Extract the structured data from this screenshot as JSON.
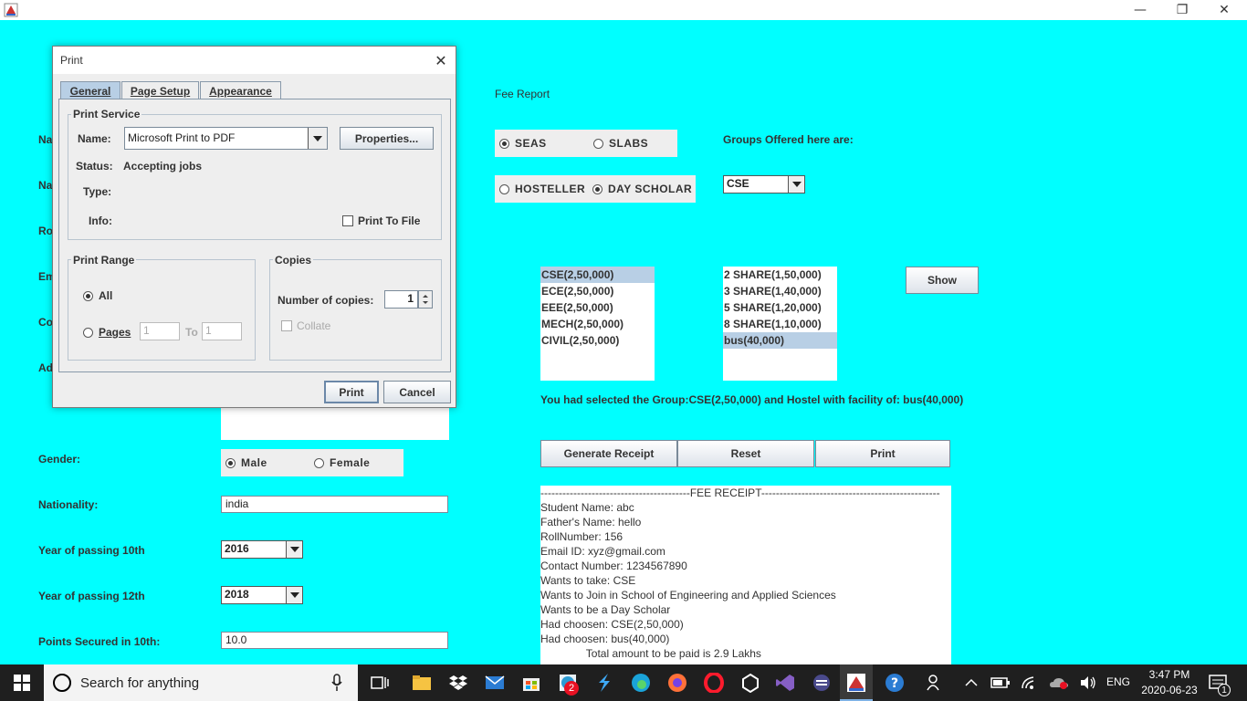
{
  "window": {
    "minimize": "—",
    "restore": "❐",
    "close": "✕"
  },
  "form": {
    "gender_label": "Gender:",
    "gender_male": "Male",
    "gender_female": "Female",
    "nationality_label": "Nationality:",
    "nationality_value": "india",
    "y10_label": "Year of passing 10th",
    "y10_value": "2016",
    "y12_label": "Year of passing 12th",
    "y12_value": "2018",
    "points_label": "Points Secured in 10th:",
    "points_value": "10.0",
    "partial_labels": [
      "Na",
      "Na",
      "Ro",
      "Em",
      "Co",
      "Ad"
    ]
  },
  "fee": {
    "title": "Fee Report",
    "seas": "SEAS",
    "slabs": "SLABS",
    "hosteller": "HOSTELLER",
    "day_scholar": "DAY SCHOLAR",
    "groups_label": "Groups Offered here are:",
    "group_combo": "CSE",
    "groups": [
      "CSE(2,50,000)",
      "ECE(2,50,000)",
      "EEE(2,50,000)",
      "MECH(2,50,000)",
      "CIVIL(2,50,000)"
    ],
    "hostels": [
      "2 SHARE(1,50,000)",
      "3 SHARE(1,40,000)",
      "5 SHARE(1,20,000)",
      "8 SHARE(1,10,000)",
      "bus(40,000)"
    ],
    "show": "Show",
    "selection_text": "You had selected the Group:CSE(2,50,000) and Hostel with facility of: bus(40,000)",
    "generate": "Generate Receipt",
    "reset": "Reset",
    "print": "Print",
    "receipt": [
      "-----------------------------------------FEE RECEIPT-------------------------------------------------",
      "Student Name: abc",
      "Father's Name: hello",
      "RollNumber: 156",
      "Email ID: xyz@gmail.com",
      "Contact Number: 1234567890",
      "Wants to take: CSE",
      "Wants to Join in School of Engineering and Applied Sciences",
      "Wants to be a Day Scholar",
      "Had choosen: CSE(2,50,000)",
      "Had choosen: bus(40,000)",
      "               Total amount to be paid is 2.9 Lakhs"
    ]
  },
  "dialog": {
    "title": "Print",
    "close": "✕",
    "tabs": [
      "General",
      "Page Setup",
      "Appearance"
    ],
    "print_service": "Print Service",
    "name_label": "Name:",
    "name_value": "Microsoft Print to PDF",
    "properties": "Properties...",
    "status_label": "Status:",
    "status_value": "Accepting jobs",
    "type_label": "Type:",
    "info_label": "Info:",
    "print_to_file": "Print To File",
    "print_range": "Print Range",
    "all": "All",
    "pages": "Pages",
    "pages_from": "1",
    "to": "To",
    "pages_to": "1",
    "copies": "Copies",
    "num_copies_label": "Number of copies:",
    "num_copies": "1",
    "collate": "Collate",
    "print_btn": "Print",
    "cancel_btn": "Cancel"
  },
  "taskbar": {
    "search": "Search for anything",
    "time": "3:47 PM",
    "date": "2020-06-23",
    "lang": "ENG",
    "badge": "2",
    "notif": "1"
  }
}
